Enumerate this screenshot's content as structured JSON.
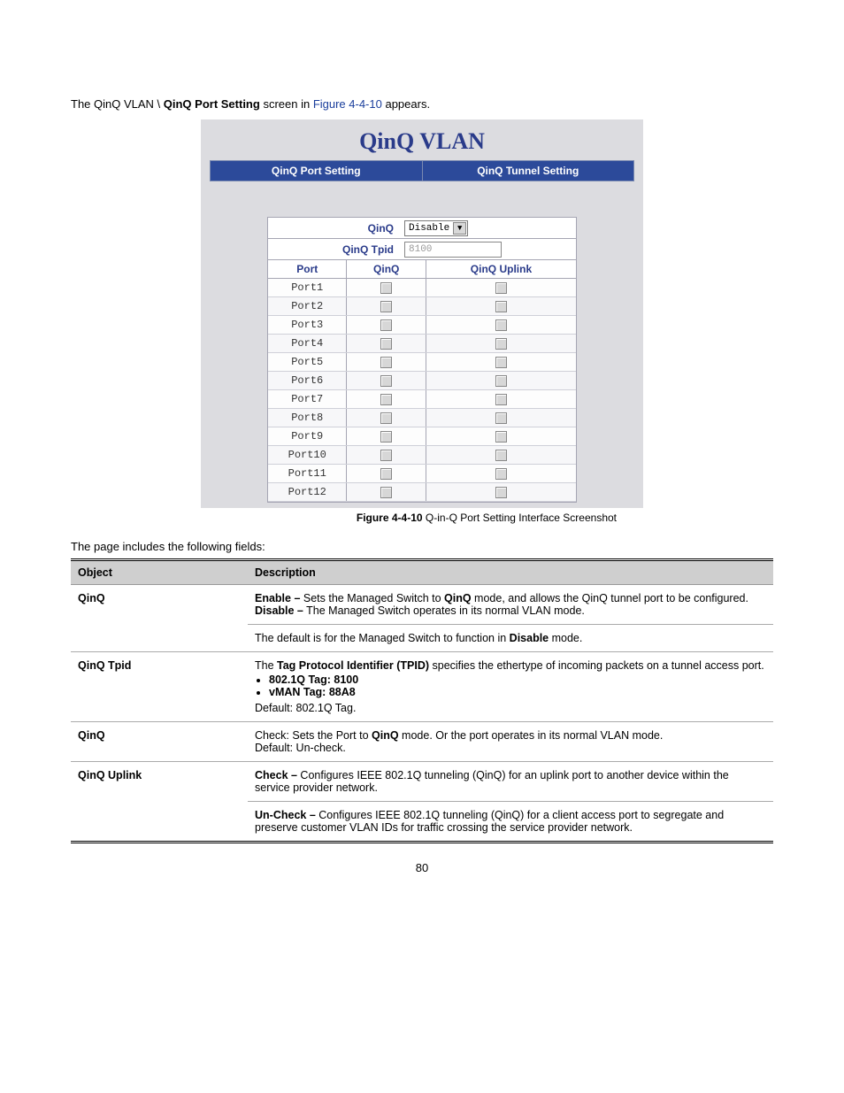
{
  "intro": {
    "pre": "The QinQ VLAN \\ ",
    "bold1": "QinQ Port Setting",
    "mid": " screen in ",
    "link": "Figure 4-4-10",
    "post": " appears."
  },
  "shot": {
    "title": "QinQ VLAN",
    "tabs": [
      "QinQ Port Setting",
      "QinQ Tunnel Setting"
    ],
    "qinq_label": "QinQ",
    "qinq_value": "Disable",
    "tpid_label": "QinQ Tpid",
    "tpid_value": "8100",
    "hdr_port": "Port",
    "hdr_qinq": "QinQ",
    "hdr_up": "QinQ Uplink",
    "ports": [
      "Port1",
      "Port2",
      "Port3",
      "Port4",
      "Port5",
      "Port6",
      "Port7",
      "Port8",
      "Port9",
      "Port10",
      "Port11",
      "Port12"
    ]
  },
  "caption": {
    "bold": "Figure 4-4-10",
    "rest": " Q-in-Q Port Setting Interface Screenshot"
  },
  "subhead": "The page includes the following fields:",
  "table": {
    "h1": "Object",
    "h2": "Description",
    "rows": [
      {
        "obj": "QinQ",
        "lines": [
          {
            "b": "Enable –",
            "t": " Sets the Managed Switch to ",
            "b2": "QinQ",
            "t2": " mode, and allows the QinQ tunnel port to be configured."
          },
          {
            "b": "Disable –",
            "t": " The Managed Switch operates in its normal VLAN mode."
          }
        ],
        "foot": {
          "pre": "The default is for the Managed Switch to function in ",
          "b": "Disable",
          "post": " mode."
        }
      },
      {
        "obj": "QinQ Tpid",
        "tpid_pre": "The ",
        "tpid_b": "Tag Protocol Identifier (TPID)",
        "tpid_post": " specifies the ethertype of incoming packets on a tunnel access port.",
        "bullets": [
          "802.1Q Tag: 8100",
          "vMAN Tag: 88A8"
        ],
        "tpid_def": "Default: 802.1Q Tag."
      },
      {
        "obj": "QinQ",
        "q_pre": "Check: Sets the Port to ",
        "q_b": "QinQ",
        "q_post": " mode. Or the port operates in its normal VLAN mode.",
        "q_def": "Default: Un-check."
      },
      {
        "obj": "QinQ Uplink",
        "up_check": {
          "b": "Check –",
          "t": " Configures IEEE 802.1Q tunneling (QinQ) for an uplink port to another device within the service provider network."
        },
        "up_un": {
          "b": "Un-Check –",
          "t": " Configures IEEE 802.1Q tunneling (QinQ) for a client access port to segregate and preserve customer VLAN IDs for traffic crossing the service provider network."
        }
      }
    ]
  },
  "pagenum": "80"
}
